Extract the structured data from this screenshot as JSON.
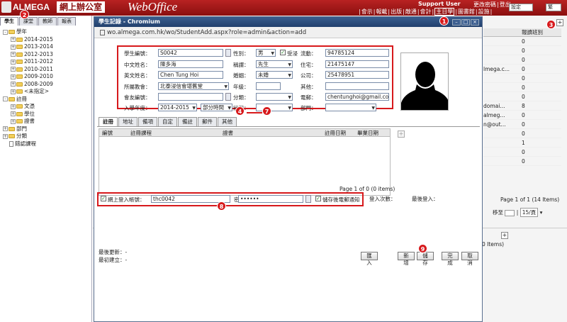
{
  "header": {
    "brand": "ALMEGA",
    "brand_cn": "網上辦公室",
    "brand_product": "WebOffice",
    "support_user": "Support User",
    "links_top": [
      "更改密碼",
      "登出"
    ],
    "links_bottom": [
      "會示",
      "報載",
      "出版",
      "敵通",
      "會計",
      "主日學",
      "圖書館",
      "設施"
    ],
    "highlighted_link": "主日學",
    "settings_select": "設定",
    "lang_select": "繁"
  },
  "left_panel": {
    "tabs": [
      "學生",
      "課堂",
      "教師",
      "報表"
    ],
    "tree": [
      {
        "label": "學年",
        "level": 0,
        "icon": "folder",
        "toggle": "-"
      },
      {
        "label": "2014-2015",
        "level": 1,
        "icon": "folder",
        "toggle": "+"
      },
      {
        "label": "2013-2014",
        "level": 1,
        "icon": "folder",
        "toggle": "+"
      },
      {
        "label": "2012-2013",
        "level": 1,
        "icon": "folder",
        "toggle": "+"
      },
      {
        "label": "2011-2012",
        "level": 1,
        "icon": "folder",
        "toggle": "+"
      },
      {
        "label": "2010-2011",
        "level": 1,
        "icon": "folder",
        "toggle": "+"
      },
      {
        "label": "2009-2010",
        "level": 1,
        "icon": "folder",
        "toggle": "+"
      },
      {
        "label": "2008-2009",
        "level": 1,
        "icon": "folder",
        "toggle": "+"
      },
      {
        "label": "<未指定>",
        "level": 1,
        "icon": "folder",
        "toggle": "+"
      },
      {
        "label": "註冊",
        "level": 0,
        "icon": "folder",
        "toggle": "-"
      },
      {
        "label": "文憑",
        "level": 1,
        "icon": "folder",
        "toggle": "+"
      },
      {
        "label": "學位",
        "level": 1,
        "icon": "folder",
        "toggle": "+"
      },
      {
        "label": "證書",
        "level": 1,
        "icon": "folder",
        "toggle": "+"
      },
      {
        "label": "部門",
        "level": 0,
        "icon": "folder",
        "toggle": "+"
      },
      {
        "label": "分類",
        "level": 0,
        "icon": "folder",
        "toggle": "+"
      },
      {
        "label": "錯認課程",
        "level": 0,
        "icon": "doc",
        "toggle": ""
      }
    ]
  },
  "right_bg": {
    "column_header": "報讀班別",
    "rows": [
      {
        "c1": "",
        "c2": "0"
      },
      {
        "c1": "",
        "c2": "0"
      },
      {
        "c1": "",
        "c2": "0"
      },
      {
        "c1": "lmega.c...",
        "c2": "0"
      },
      {
        "c1": "",
        "c2": "0"
      },
      {
        "c1": "",
        "c2": "0"
      },
      {
        "c1": "",
        "c2": "0"
      },
      {
        "c1": "domai...",
        "c2": "8"
      },
      {
        "c1": "almeg...",
        "c2": "0"
      },
      {
        "c1": "n@out...",
        "c2": "0"
      },
      {
        "c1": "",
        "c2": "0"
      },
      {
        "c1": "",
        "c2": "1"
      },
      {
        "c1": "",
        "c2": "0"
      },
      {
        "c1": "",
        "c2": "0"
      }
    ],
    "pager": "Page 1 of 1 (14 Items)",
    "pager_sub": "移至",
    "page_size": "15/頁",
    "items_text": "0 Items)"
  },
  "popup": {
    "title": "學生記錄 - Chromium",
    "url": "wo.almega.com.hk/wo/StudentAdd.aspx?role=admin&action=add",
    "form": {
      "student_no_label": "學生編號：",
      "student_no": "S0042",
      "gender_label": "性別：",
      "gender": "男",
      "baptized_label": "受浸",
      "mobile_label": "流動：",
      "mobile": "94785124",
      "cn_name_label": "中文姓名：",
      "cn_name": "陳多海",
      "title_label": "稱謂：",
      "title": "先生",
      "home_label": "住宅：",
      "home": "21475147",
      "en_name_label": "英文姓名：",
      "en_name": "Chen Tung Hoi",
      "marital_label": "婚姻：",
      "marital": "未婚",
      "office_label": "公司：",
      "office": "25478951",
      "church_label": "所屬教會：",
      "church": "北泰浸信會堪舊堂",
      "grade_label": "年級：",
      "other_label": "其他：",
      "alumni_label": "會友編號：",
      "category_label": "分類：",
      "email_label": "電郵：",
      "email": "chentunghoi@gmail.com",
      "enroll_year_label": "入學年度：",
      "enroll_year": "2014-2015",
      "session": "部分時間",
      "status_label": "狀況：",
      "dept_label": "部門："
    },
    "tabs": [
      "註冊",
      "地址",
      "備項",
      "自定",
      "備註",
      "郵件",
      "其他"
    ],
    "grid": {
      "headers": [
        "編號",
        "註冊課程",
        "證書",
        "註冊日期",
        "畢業日期"
      ],
      "pager": "Page 1 of 0 (0 items)"
    },
    "login": {
      "enable_label": "網上登入帳號：",
      "account": "thc0042",
      "password_label": "密碼：",
      "password": "••••••",
      "notify_label": "儲存後電郵通知",
      "count_label": "登入次數：",
      "last_login_label": "最後登入："
    },
    "footer": {
      "last_updated": "最後更新：-",
      "created": "最初建立：-",
      "import_btn": "匯入",
      "new_btn": "新增",
      "save_btn": "儲存",
      "done_btn": "完成",
      "cancel_btn": "取消"
    }
  },
  "markers": [
    "1",
    "2",
    "3",
    "4",
    "7",
    "8",
    "9"
  ],
  "colors": {
    "header": "#a01818",
    "accent_red": "#d7191c",
    "popup_title": "#2b4a7a"
  }
}
